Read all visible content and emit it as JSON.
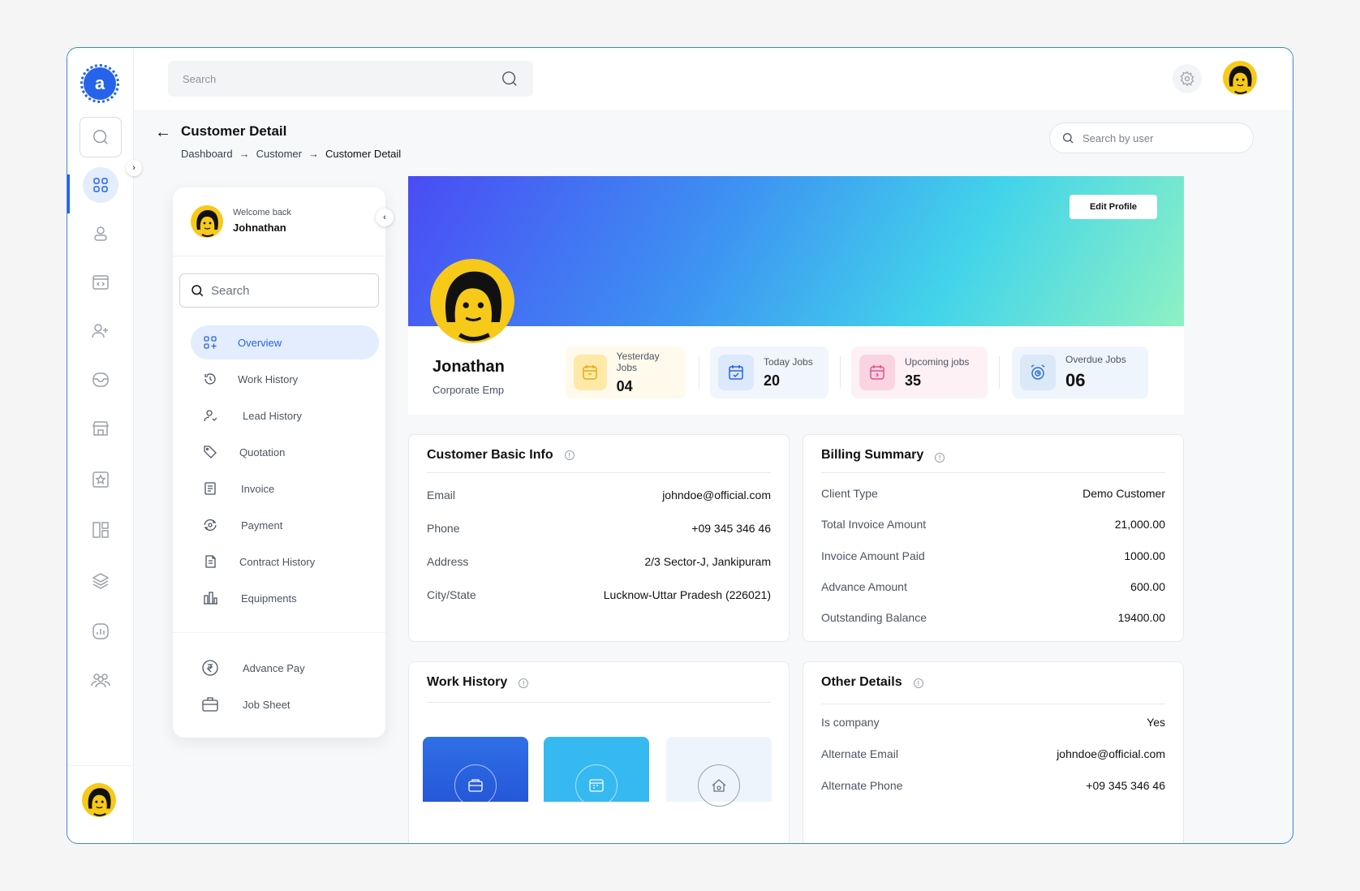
{
  "topbar": {
    "search_placeholder": "Search"
  },
  "header": {
    "title": "Customer Detail",
    "breadcrumb": [
      "Dashboard",
      "Customer",
      "Customer Detail"
    ],
    "user_search_placeholder": "Search by user"
  },
  "panel": {
    "welcome": "Welcome back",
    "user": "Johnathan",
    "search_placeholder": "Search",
    "nav": [
      {
        "label": "Overview",
        "icon": "grid-plus-icon",
        "active": true
      },
      {
        "label": "Work History",
        "icon": "history-icon"
      },
      {
        "label": "Lead History",
        "icon": "user-lead-icon"
      },
      {
        "label": "Quotation",
        "icon": "tag-icon"
      },
      {
        "label": "Invoice",
        "icon": "invoice-icon"
      },
      {
        "label": "Payment",
        "icon": "payment-icon"
      },
      {
        "label": "Contract History",
        "icon": "contract-icon"
      },
      {
        "label": "Equipments",
        "icon": "equipment-icon"
      }
    ],
    "extra": [
      {
        "label": "Advance Pay",
        "icon": "rupee-icon"
      },
      {
        "label": "Job Sheet",
        "icon": "briefcase-icon"
      }
    ]
  },
  "profile": {
    "edit_label": "Edit Profile",
    "name": "Jonathan",
    "role": "Corporate Emp",
    "stats": [
      {
        "label": "Yesterday Jobs",
        "value": "04",
        "bg": "#fffaeb",
        "icon_bg": "#ffe9a8",
        "color": "#e7a911"
      },
      {
        "label": "Today Jobs",
        "value": "20",
        "bg": "#f1f6fd",
        "icon_bg": "#dce8fb",
        "color": "#2563eb"
      },
      {
        "label": "Upcoming jobs",
        "value": "35",
        "bg": "#fdf1f5",
        "icon_bg": "#fbd4e2",
        "color": "#e4508a"
      },
      {
        "label": "Overdue Jobs",
        "value": "06",
        "bg": "#eef5fd",
        "icon_bg": "#dbe8f8",
        "color": "#2f74c9"
      }
    ]
  },
  "basic_info": {
    "title": "Customer Basic Info",
    "rows": [
      {
        "k": "Email",
        "v": "johndoe@official.com"
      },
      {
        "k": "Phone",
        "v": "+09 345 346 46"
      },
      {
        "k": "Address",
        "v": "2/3 Sector-J, Jankipuram"
      },
      {
        "k": "City/State",
        "v": "Lucknow-Uttar Pradesh (226021)"
      }
    ]
  },
  "billing": {
    "title": "Billing Summary",
    "rows": [
      {
        "k": "Client Type",
        "v": "Demo Customer"
      },
      {
        "k": "Total Invoice Amount",
        "v": "21,000.00"
      },
      {
        "k": "Invoice Amount Paid",
        "v": "1000.00"
      },
      {
        "k": "Advance Amount",
        "v": "600.00"
      },
      {
        "k": "Outstanding Balance",
        "v": "19400.00"
      }
    ]
  },
  "work_history": {
    "title": "Work History"
  },
  "other": {
    "title": "Other Details",
    "rows": [
      {
        "k": "Is company",
        "v": "Yes"
      },
      {
        "k": "Alternate Email",
        "v": "johndoe@official.com"
      },
      {
        "k": "Alternate Phone",
        "v": "+09 345 346 46"
      }
    ]
  },
  "colors": {
    "accent": "#2563eb",
    "frame": "#3a86d4"
  }
}
